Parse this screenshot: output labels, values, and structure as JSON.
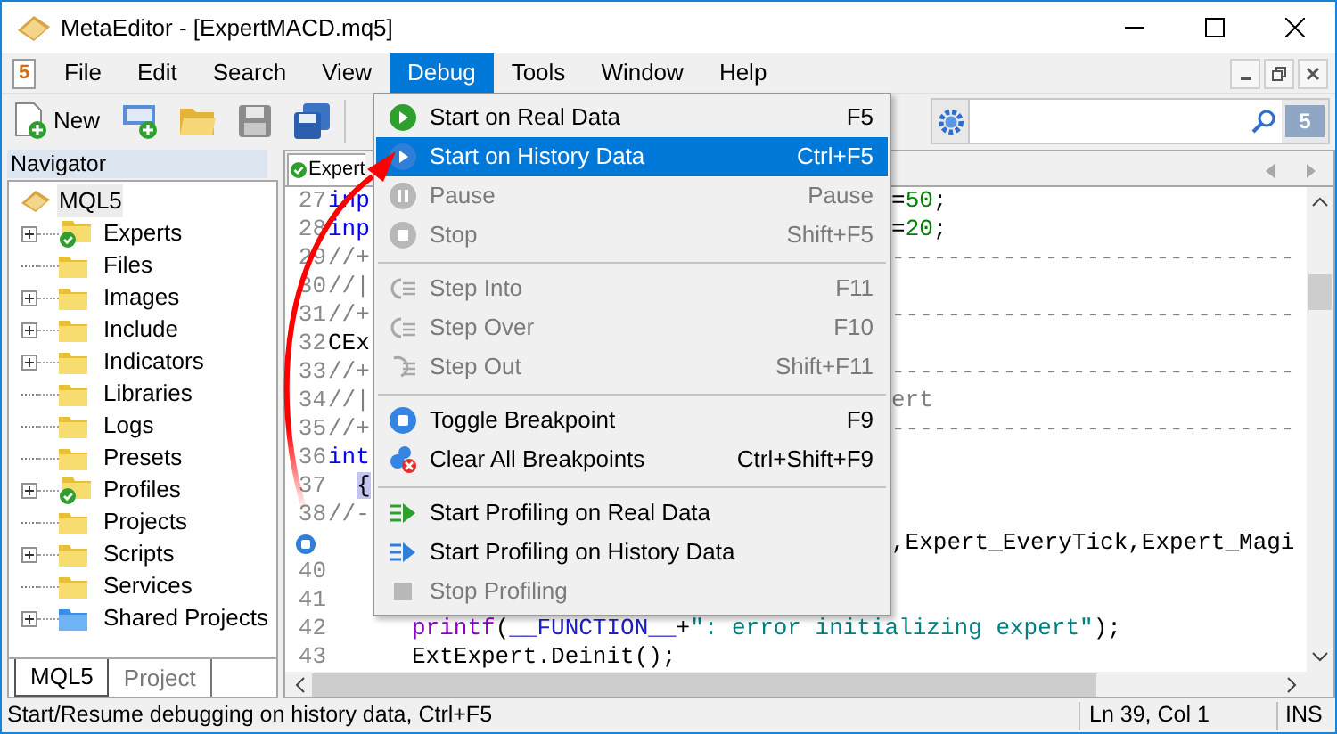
{
  "window": {
    "title": "MetaEditor - [ExpertMACD.mq5]"
  },
  "menu_icon": "5",
  "menu_bar": [
    {
      "label": "File",
      "selected": false
    },
    {
      "label": "Edit",
      "selected": false
    },
    {
      "label": "Search",
      "selected": false
    },
    {
      "label": "View",
      "selected": false
    },
    {
      "label": "Debug",
      "selected": true
    },
    {
      "label": "Tools",
      "selected": false
    },
    {
      "label": "Window",
      "selected": false
    },
    {
      "label": "Help",
      "selected": false
    }
  ],
  "toolbar": {
    "new_button": "New",
    "chat_badge": "5"
  },
  "navigator": {
    "title": "Navigator",
    "root": {
      "label": "MQL5",
      "selected": true
    },
    "items": [
      {
        "label": "Experts",
        "kind": "checked",
        "expandable": true,
        "selected": false
      },
      {
        "label": "Files",
        "kind": "folder",
        "expandable": false,
        "selected": false
      },
      {
        "label": "Images",
        "kind": "folder",
        "expandable": true,
        "selected": false
      },
      {
        "label": "Include",
        "kind": "folder",
        "expandable": true,
        "selected": false
      },
      {
        "label": "Indicators",
        "kind": "folder",
        "expandable": true,
        "selected": false
      },
      {
        "label": "Libraries",
        "kind": "folder",
        "expandable": false,
        "selected": false
      },
      {
        "label": "Logs",
        "kind": "folder",
        "expandable": false,
        "selected": false
      },
      {
        "label": "Presets",
        "kind": "folder",
        "expandable": false,
        "selected": false
      },
      {
        "label": "Profiles",
        "kind": "checked",
        "expandable": true,
        "selected": false
      },
      {
        "label": "Projects",
        "kind": "folder",
        "expandable": false,
        "selected": false
      },
      {
        "label": "Scripts",
        "kind": "folder",
        "expandable": true,
        "selected": false
      },
      {
        "label": "Services",
        "kind": "folder",
        "expandable": false,
        "selected": false
      },
      {
        "label": "Shared Projects",
        "kind": "shared",
        "expandable": true,
        "selected": false
      }
    ],
    "tabs": [
      {
        "label": "MQL5",
        "selected": true
      },
      {
        "label": "Project",
        "selected": false
      }
    ]
  },
  "editor": {
    "tab_label": "Expert",
    "lines": [
      {
        "number": "27",
        "breakpoint": false,
        "indent": false,
        "left": [
          {
            "text": "inp",
            "kind": "keyword"
          }
        ],
        "right": [
          {
            "text": "=",
            "kind": "plain"
          },
          {
            "text": "50",
            "kind": "number"
          },
          {
            "text": ";",
            "kind": "plain"
          }
        ]
      },
      {
        "number": "28",
        "breakpoint": false,
        "indent": false,
        "left": [
          {
            "text": "inp",
            "kind": "keyword"
          }
        ],
        "right": [
          {
            "text": "=",
            "kind": "plain"
          },
          {
            "text": "20",
            "kind": "number"
          },
          {
            "text": ";",
            "kind": "plain"
          }
        ]
      },
      {
        "number": "29",
        "breakpoint": false,
        "indent": false,
        "left": [
          {
            "text": "//+",
            "kind": "comment"
          }
        ],
        "right": [
          {
            "text": "-----------------------------",
            "kind": "comment"
          }
        ]
      },
      {
        "number": "30",
        "breakpoint": false,
        "indent": false,
        "left": [
          {
            "text": "//|",
            "kind": "comment"
          }
        ]
      },
      {
        "number": "31",
        "breakpoint": false,
        "indent": false,
        "left": [
          {
            "text": "//+",
            "kind": "comment"
          }
        ],
        "right": [
          {
            "text": "-----------------------------",
            "kind": "comment"
          }
        ]
      },
      {
        "number": "32",
        "breakpoint": false,
        "indent": false,
        "left": [
          {
            "text": "CEx",
            "kind": "plain"
          }
        ]
      },
      {
        "number": "33",
        "breakpoint": false,
        "indent": false,
        "left": [
          {
            "text": "//+",
            "kind": "comment"
          }
        ],
        "right": [
          {
            "text": "-----------------------------",
            "kind": "comment"
          }
        ]
      },
      {
        "number": "34",
        "breakpoint": false,
        "indent": false,
        "left": [
          {
            "text": "//|",
            "kind": "comment"
          }
        ],
        "right": [
          {
            "text": "ert",
            "kind": "comment"
          }
        ]
      },
      {
        "number": "35",
        "breakpoint": false,
        "indent": false,
        "left": [
          {
            "text": "//+",
            "kind": "comment"
          }
        ],
        "right": [
          {
            "text": "-----------------------------",
            "kind": "comment"
          }
        ]
      },
      {
        "number": "36",
        "breakpoint": false,
        "indent": false,
        "left": [
          {
            "text": "int",
            "kind": "keyword"
          }
        ]
      },
      {
        "number": "37",
        "breakpoint": false,
        "indent": false,
        "left": [
          {
            "text": "{",
            "kind": "brace"
          }
        ]
      },
      {
        "number": "38",
        "breakpoint": false,
        "indent": false,
        "left": [
          {
            "text": "//-",
            "kind": "comment"
          }
        ]
      },
      {
        "breakpoint": true,
        "right": [
          {
            "text": ",Expert_EveryTick,Expert_Magi",
            "kind": "plain"
          }
        ]
      },
      {
        "number": "40",
        "breakpoint": false
      },
      {
        "number": "41",
        "breakpoint": false
      },
      {
        "number": "42",
        "breakpoint": false,
        "indent": true,
        "left": [
          {
            "text": "printf",
            "kind": "func"
          },
          {
            "text": "(",
            "kind": "plain"
          },
          {
            "text": "__FUNCTION__",
            "kind": "macro"
          },
          {
            "text": "+",
            "kind": "plain"
          },
          {
            "text": "\": error initializing expert\"",
            "kind": "string"
          },
          {
            "text": ");",
            "kind": "plain"
          }
        ]
      },
      {
        "number": "43",
        "breakpoint": false,
        "indent": true,
        "left": [
          {
            "text": "ExtExpert.Deinit();",
            "kind": "plain"
          }
        ]
      }
    ]
  },
  "debug_menu": [
    {
      "kind": "item",
      "label": "Start on Real Data",
      "shortcut": "F5",
      "selected": false,
      "disabled": false
    },
    {
      "kind": "item",
      "label": "Start on History Data",
      "shortcut": "Ctrl+F5",
      "selected": true,
      "disabled": false
    },
    {
      "kind": "item",
      "label": "Pause",
      "shortcut": "Pause",
      "selected": false,
      "disabled": true
    },
    {
      "kind": "item",
      "label": "Stop",
      "shortcut": "Shift+F5",
      "selected": false,
      "disabled": true
    },
    {
      "kind": "separator"
    },
    {
      "kind": "item",
      "label": "Step Into",
      "shortcut": "F11",
      "selected": false,
      "disabled": true
    },
    {
      "kind": "item",
      "label": "Step Over",
      "shortcut": "F10",
      "selected": false,
      "disabled": true
    },
    {
      "kind": "item",
      "label": "Step Out",
      "shortcut": "Shift+F11",
      "selected": false,
      "disabled": true
    },
    {
      "kind": "separator"
    },
    {
      "kind": "item",
      "label": "Toggle Breakpoint",
      "shortcut": "F9",
      "selected": false,
      "disabled": false
    },
    {
      "kind": "item",
      "label": "Clear All Breakpoints",
      "shortcut": "Ctrl+Shift+F9",
      "selected": false,
      "disabled": false
    },
    {
      "kind": "separator"
    },
    {
      "kind": "item",
      "label": "Start Profiling on Real Data",
      "selected": false,
      "disabled": false
    },
    {
      "kind": "item",
      "label": "Start Profiling on History Data",
      "selected": false,
      "disabled": false
    },
    {
      "kind": "item",
      "label": "Stop Profiling",
      "selected": false,
      "disabled": true
    }
  ],
  "status_bar": {
    "message": "Start/Resume debugging on history data, Ctrl+F5",
    "position": "Ln 39, Col 1",
    "mode": "INS"
  }
}
